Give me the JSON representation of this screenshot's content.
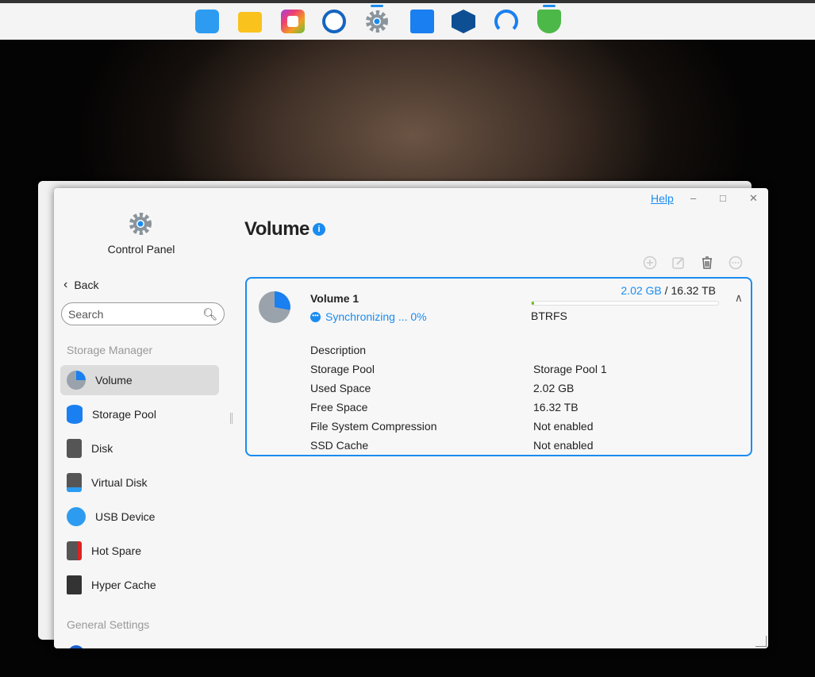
{
  "taskbar": {
    "apps": [
      {
        "name": "app-layout-icon",
        "color": "#2d9cf0"
      },
      {
        "name": "folder-icon",
        "color": "#f9c21c"
      },
      {
        "name": "photos-icon",
        "color": "#e84b8a"
      },
      {
        "name": "backup-clock-icon",
        "color": "#1565c0"
      },
      {
        "name": "settings-gear-icon",
        "color": "#8a949c",
        "active": true
      },
      {
        "name": "app-store-bag-icon",
        "color": "#1a7ff0"
      },
      {
        "name": "docker-icon",
        "color": "#0e4f94"
      },
      {
        "name": "support-headset-icon",
        "color": "#1a7ff0"
      },
      {
        "name": "security-shield-icon",
        "color": "#4cb848",
        "active": true
      }
    ]
  },
  "window": {
    "help": "Help"
  },
  "sidebar": {
    "app_title": "Control Panel",
    "back": "Back",
    "search_placeholder": "Search",
    "section1": "Storage Manager",
    "items": [
      {
        "label": "Volume"
      },
      {
        "label": "Storage Pool"
      },
      {
        "label": "Disk"
      },
      {
        "label": "Virtual Disk"
      },
      {
        "label": "USB Device"
      },
      {
        "label": "Hot Spare"
      },
      {
        "label": "Hyper Cache"
      }
    ],
    "section2": "General Settings"
  },
  "main": {
    "title": "Volume",
    "volume": {
      "name": "Volume 1",
      "status": "Synchronizing ... 0%",
      "used": "2.02 GB",
      "separator": "/",
      "total": "16.32 TB",
      "usage_fraction": 0.0001,
      "filesystem": "BTRFS",
      "details": [
        {
          "label": "Description",
          "value": ""
        },
        {
          "label": "Storage Pool",
          "value": "Storage Pool 1"
        },
        {
          "label": "Used Space",
          "value": "2.02 GB"
        },
        {
          "label": "Free Space",
          "value": "16.32 TB"
        },
        {
          "label": "File System Compression",
          "value": "Not enabled"
        },
        {
          "label": "SSD Cache",
          "value": "Not enabled"
        }
      ]
    }
  }
}
